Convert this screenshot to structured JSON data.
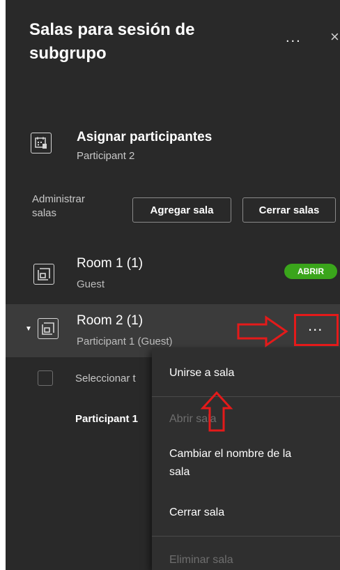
{
  "header": {
    "title": "Salas para sesión de subgrupo",
    "more_label": "...",
    "close_label": "×"
  },
  "assign": {
    "title": "Asignar participantes",
    "subtitle": "Participant 2"
  },
  "admin": {
    "label": "Administrar salas",
    "add_button": "Agregar sala",
    "close_button": "Cerrar salas"
  },
  "rooms": [
    {
      "name": "Room 1 (1)",
      "participants": "Guest",
      "badge": "ABRIR"
    },
    {
      "name": "Room 2 (1)",
      "participants": "Participant 1 (Guest)",
      "more_label": "..."
    }
  ],
  "room2_expanded": {
    "select_all": "Seleccionar t",
    "participant": "Participant 1"
  },
  "context_menu": {
    "items": [
      {
        "label": "Unirse a sala",
        "enabled": true
      },
      {
        "label": "Abrir sala",
        "enabled": false
      },
      {
        "label": "Cambiar el nombre de la sala",
        "enabled": true
      },
      {
        "label": "Cerrar sala",
        "enabled": true
      },
      {
        "label": "Eliminar sala",
        "enabled": false
      }
    ]
  },
  "colors": {
    "panel_bg": "#292929",
    "menu_bg": "#2f2f2f",
    "badge_green": "#3aa51b",
    "annotation_red": "#e41a1a"
  },
  "icons": {
    "assign": "calendar-grid-icon",
    "room": "room-icon",
    "annotation_arrows": [
      "red-arrow-right",
      "red-arrow-up"
    ]
  }
}
